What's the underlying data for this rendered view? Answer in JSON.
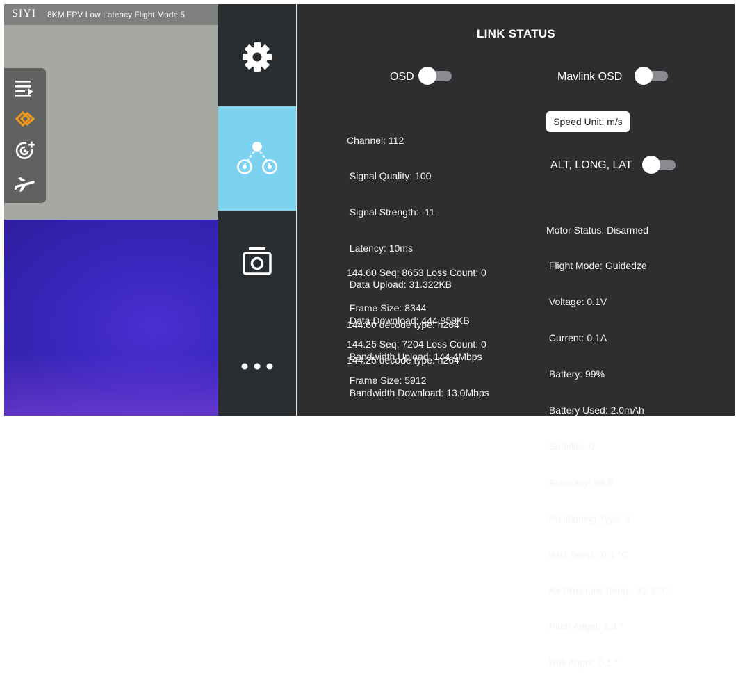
{
  "camera": {
    "brand": "SIYI",
    "mode_title": "8KM FPV Low Latency Flight Mode 5",
    "tools": [
      {
        "icon": "list-play-icon",
        "color": "#ffffff"
      },
      {
        "icon": "link-chain-icon",
        "color": "#f39a1e"
      },
      {
        "icon": "target-add-icon",
        "color": "#ffffff"
      },
      {
        "icon": "airplane-icon",
        "color": "#ffffff"
      }
    ]
  },
  "menu": {
    "items": [
      {
        "id": "settings",
        "icon": "gear-icon"
      },
      {
        "id": "link",
        "icon": "link-status-icon",
        "active": true,
        "active_color": "#7dd3ef"
      },
      {
        "id": "camera",
        "icon": "camera-icon"
      },
      {
        "id": "more",
        "icon": "more-dots-icon"
      }
    ]
  },
  "panel": {
    "title": "LINK STATUS",
    "osd": {
      "label": "OSD",
      "on": false
    },
    "mavlink_osd": {
      "label": "Mavlink OSD",
      "on": false
    },
    "speed_unit": "Speed Unit: m/s",
    "alt_long_lat": {
      "label": "ALT, LONG, LAT",
      "on": false
    },
    "link_stats": [
      "Channel: 112",
      " Signal Quality: 100",
      " Signal Strength: -11",
      " Latency: 10ms",
      " Data Upload: 31.322KB",
      " Data Download: 444.959KB",
      " Bandwidth Upload: 144.4Mbps",
      " Bandwidth Download: 13.0Mbps"
    ],
    "stream_stats": [
      "144.60 Seq: 8653 Loss Count: 0",
      " Frame Size: 8344",
      "144.25 Seq: 7204 Loss Count: 0",
      " Frame Size: 5912"
    ],
    "decode_stats": [
      "144.60 decode type: h264",
      "144.25 decode type: h264"
    ],
    "flight_stats": [
      "Motor Status: Disarmed",
      " Flight Mode: Guidedze",
      " Voltage: 0.1V",
      " Current: 0.1A",
      " Battery: 99%",
      " Battery Used: 2.0mAh",
      " Satellite: 0",
      " Accuracy: 99.9",
      " Positioning Type: 1",
      " IMU Temp.: 0.1 °C",
      " Air Pressure Temp.: 32.3 °C",
      " Pitch Angel: 1.3 °",
      " Roll Angel: 0.1 °"
    ]
  }
}
